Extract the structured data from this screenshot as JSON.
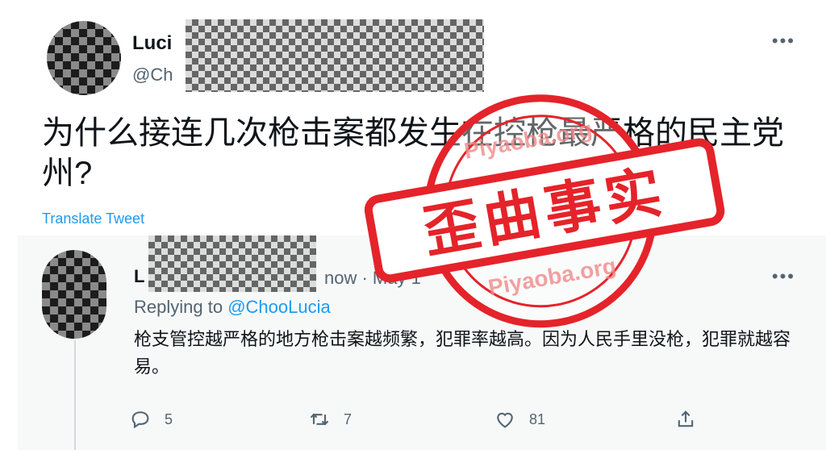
{
  "main_tweet": {
    "name_visible": "Luci",
    "handle_visible": "@Ch",
    "more": "•••",
    "text": "为什么接连几次枪击案都发生在控枪最严格的民主党州?",
    "translate": "Translate Tweet"
  },
  "reply": {
    "name_visible": "L",
    "meta_visible": "now · May 1",
    "more": "•••",
    "replying_prefix": "Replying to ",
    "replying_handle": "@ChooLucia",
    "text": "枪支管控越严格的地方枪击案越频繁，犯罪率越高。因为人民手里没枪，犯罪就越容易。",
    "actions": {
      "reply_count": "5",
      "retweet_count": "7",
      "like_count": "81"
    }
  },
  "stamp": {
    "label": "歪曲事实",
    "watermark": "Piyaoba.org",
    "color": "#e5232a"
  },
  "icons": [
    "more-icon",
    "reply-icon",
    "retweet-icon",
    "like-icon",
    "share-icon"
  ]
}
